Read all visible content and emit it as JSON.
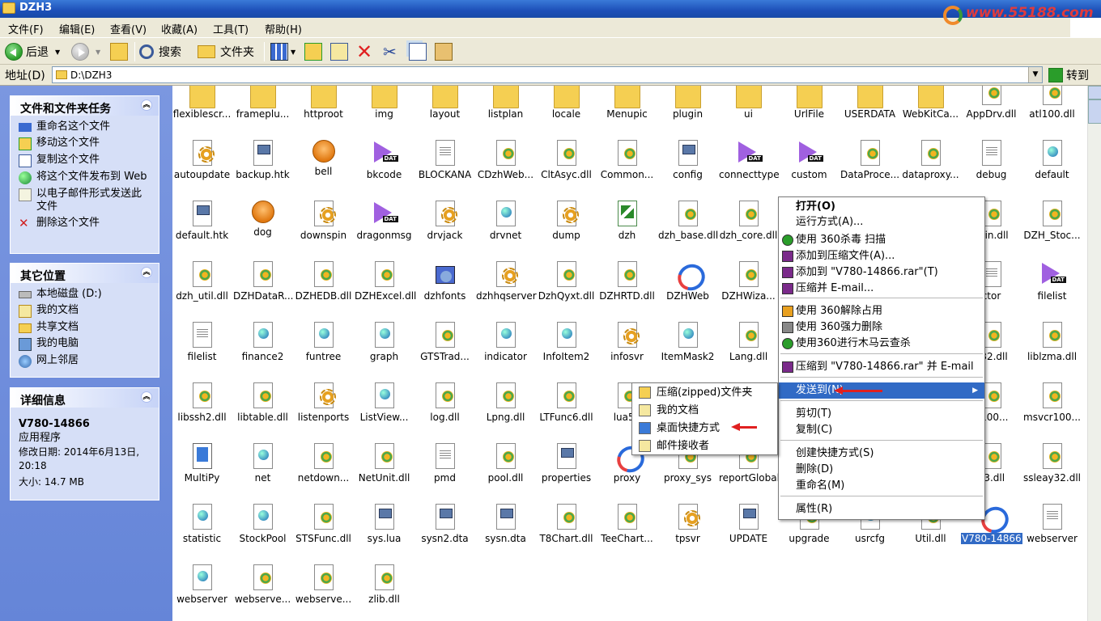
{
  "window": {
    "title": "DZH3"
  },
  "watermark": {
    "text": "www.55188.com"
  },
  "menubar": {
    "items": [
      "文件(F)",
      "编辑(E)",
      "查看(V)",
      "收藏(A)",
      "工具(T)",
      "帮助(H)"
    ]
  },
  "toolbar": {
    "back": "后退",
    "search": "搜索",
    "folders": "文件夹"
  },
  "address": {
    "label": "地址(D)",
    "value": "D:\\DZH3",
    "go": "转到"
  },
  "sidebar": {
    "tasks": {
      "title": "文件和文件夹任务",
      "items": [
        "重命名这个文件",
        "移动这个文件",
        "复制这个文件",
        "将这个文件发布到 Web",
        "以电子邮件形式发送此文件",
        "删除这个文件"
      ]
    },
    "places": {
      "title": "其它位置",
      "items": [
        "本地磁盘 (D:)",
        "我的文档",
        "共享文档",
        "我的电脑",
        "网上邻居"
      ]
    },
    "details": {
      "title": "详细信息",
      "name": "V780-14866",
      "type": "应用程序",
      "modified": "修改日期: 2014年6月13日, 20:18",
      "size": "大小: 14.7 MB"
    }
  },
  "files": [
    {
      "name": "flexiblescr...",
      "icon": "folder"
    },
    {
      "name": "frameplu...",
      "icon": "folder"
    },
    {
      "name": "httproot",
      "icon": "folder"
    },
    {
      "name": "img",
      "icon": "folder"
    },
    {
      "name": "layout",
      "icon": "folder"
    },
    {
      "name": "listplan",
      "icon": "folder"
    },
    {
      "name": "locale",
      "icon": "folder"
    },
    {
      "name": "Menupic",
      "icon": "folder"
    },
    {
      "name": "plugin",
      "icon": "folder"
    },
    {
      "name": "ui",
      "icon": "folder"
    },
    {
      "name": "UrlFile",
      "icon": "folder"
    },
    {
      "name": "USERDATA",
      "icon": "folder"
    },
    {
      "name": "WebKitCa...",
      "icon": "folder"
    },
    {
      "name": "AppDrv.dll",
      "icon": "dll"
    },
    {
      "name": "atl100.dll",
      "icon": "dll"
    },
    {
      "name": "autoupdate",
      "icon": "gear"
    },
    {
      "name": "backup.htk",
      "icon": "htk"
    },
    {
      "name": "bell",
      "icon": "round"
    },
    {
      "name": "bkcode",
      "icon": "dat"
    },
    {
      "name": "BLOCKANA",
      "icon": "doc"
    },
    {
      "name": "CDzhWeb...",
      "icon": "dll"
    },
    {
      "name": "CltAsyc.dll",
      "icon": "dll"
    },
    {
      "name": "Common...",
      "icon": "dll"
    },
    {
      "name": "config",
      "icon": "htk"
    },
    {
      "name": "connecttype",
      "icon": "dat"
    },
    {
      "name": "custom",
      "icon": "dat"
    },
    {
      "name": "DataProce...",
      "icon": "dll"
    },
    {
      "name": "dataproxy...",
      "icon": "dll"
    },
    {
      "name": "debug",
      "icon": "doc"
    },
    {
      "name": "default",
      "icon": "web"
    },
    {
      "name": "default.htk",
      "icon": "htk"
    },
    {
      "name": "dog",
      "icon": "round"
    },
    {
      "name": "downspin",
      "icon": "gear"
    },
    {
      "name": "dragonmsg",
      "icon": "dat"
    },
    {
      "name": "drvjack",
      "icon": "gear"
    },
    {
      "name": "drvnet",
      "icon": "web"
    },
    {
      "name": "dump",
      "icon": "gear"
    },
    {
      "name": "dzh",
      "icon": "xls"
    },
    {
      "name": "dzh_base.dll",
      "icon": "dll"
    },
    {
      "name": "dzh_core.dll",
      "icon": "dll"
    },
    {
      "name": "",
      "icon": "none"
    },
    {
      "name": "",
      "icon": "none"
    },
    {
      "name": "",
      "icon": "none"
    },
    {
      "name": "skin.dll",
      "icon": "dll"
    },
    {
      "name": "DZH_Stoc...",
      "icon": "dll"
    },
    {
      "name": "dzh_util.dll",
      "icon": "dll"
    },
    {
      "name": "DZHDataR...",
      "icon": "dll"
    },
    {
      "name": "DZHEDB.dll",
      "icon": "dll"
    },
    {
      "name": "DZHExcel.dll",
      "icon": "dll"
    },
    {
      "name": "dzhfonts",
      "icon": "install"
    },
    {
      "name": "dzhhqserver",
      "icon": "gear"
    },
    {
      "name": "DzhQyxt.dll",
      "icon": "dll"
    },
    {
      "name": "DZHRTD.dll",
      "icon": "dll"
    },
    {
      "name": "DZHWeb",
      "icon": "app"
    },
    {
      "name": "DZHWiza...",
      "icon": "dll"
    },
    {
      "name": "",
      "icon": "none"
    },
    {
      "name": "",
      "icon": "none"
    },
    {
      "name": "",
      "icon": "none"
    },
    {
      "name": "ctor",
      "icon": "doc"
    },
    {
      "name": "filelist",
      "icon": "dat"
    },
    {
      "name": "filelist",
      "icon": "doc"
    },
    {
      "name": "finance2",
      "icon": "web"
    },
    {
      "name": "funtree",
      "icon": "web"
    },
    {
      "name": "graph",
      "icon": "web"
    },
    {
      "name": "GTSTrad...",
      "icon": "dll"
    },
    {
      "name": "indicator",
      "icon": "web"
    },
    {
      "name": "InfoItem2",
      "icon": "web"
    },
    {
      "name": "infosvr",
      "icon": "gear"
    },
    {
      "name": "ItemMask2",
      "icon": "web"
    },
    {
      "name": "Lang.dll",
      "icon": "dll"
    },
    {
      "name": "",
      "icon": "none"
    },
    {
      "name": "",
      "icon": "none"
    },
    {
      "name": "",
      "icon": "none"
    },
    {
      "name": "y32.dll",
      "icon": "dll"
    },
    {
      "name": "liblzma.dll",
      "icon": "dll"
    },
    {
      "name": "libssh2.dll",
      "icon": "dll"
    },
    {
      "name": "libtable.dll",
      "icon": "dll"
    },
    {
      "name": "listenports",
      "icon": "gear"
    },
    {
      "name": "ListView...",
      "icon": "web"
    },
    {
      "name": "log.dll",
      "icon": "dll"
    },
    {
      "name": "Lpng.dll",
      "icon": "dll"
    },
    {
      "name": "LTFunc6.dll",
      "icon": "dll"
    },
    {
      "name": "lua51",
      "icon": "dll"
    },
    {
      "name": "",
      "icon": "none"
    },
    {
      "name": "",
      "icon": "none"
    },
    {
      "name": "",
      "icon": "none"
    },
    {
      "name": "",
      "icon": "none"
    },
    {
      "name": "",
      "icon": "none"
    },
    {
      "name": "p100...",
      "icon": "dll"
    },
    {
      "name": "msvcr100...",
      "icon": "dll"
    },
    {
      "name": "MultiPy",
      "icon": "multi"
    },
    {
      "name": "net",
      "icon": "web"
    },
    {
      "name": "netdown...",
      "icon": "dll"
    },
    {
      "name": "NetUnit.dll",
      "icon": "dll"
    },
    {
      "name": "pmd",
      "icon": "doc"
    },
    {
      "name": "pool.dll",
      "icon": "dll"
    },
    {
      "name": "properties",
      "icon": "htk"
    },
    {
      "name": "proxy",
      "icon": "app"
    },
    {
      "name": "proxy_sys",
      "icon": "dll"
    },
    {
      "name": "reportGlobal",
      "icon": "dll"
    },
    {
      "name": "",
      "icon": "none"
    },
    {
      "name": "",
      "icon": "none"
    },
    {
      "name": "",
      "icon": "none"
    },
    {
      "name": "e3.dll",
      "icon": "dll"
    },
    {
      "name": "ssleay32.dll",
      "icon": "dll"
    },
    {
      "name": "statistic",
      "icon": "web"
    },
    {
      "name": "StockPool",
      "icon": "web"
    },
    {
      "name": "STSFunc.dll",
      "icon": "dll"
    },
    {
      "name": "sys.lua",
      "icon": "htk"
    },
    {
      "name": "sysn2.dta",
      "icon": "htk"
    },
    {
      "name": "sysn.dta",
      "icon": "htk"
    },
    {
      "name": "T8Chart.dll",
      "icon": "dll"
    },
    {
      "name": "TeeChart...",
      "icon": "dll"
    },
    {
      "name": "tpsvr",
      "icon": "gear"
    },
    {
      "name": "UPDATE",
      "icon": "htk"
    },
    {
      "name": "upgrade",
      "icon": "dll"
    },
    {
      "name": "usrcfg",
      "icon": "web"
    },
    {
      "name": "Util.dll",
      "icon": "dll"
    },
    {
      "name": "V780-14866",
      "icon": "app",
      "selected": true
    },
    {
      "name": "webserver",
      "icon": "doc"
    },
    {
      "name": "webserver",
      "icon": "web"
    },
    {
      "name": "webserve...",
      "icon": "dll"
    },
    {
      "name": "webserve...",
      "icon": "dll"
    },
    {
      "name": "zlib.dll",
      "icon": "dll"
    }
  ],
  "context_menu": {
    "items": [
      {
        "label": "打开(O)",
        "bold": true
      },
      {
        "label": "运行方式(A)..."
      },
      {
        "label": "使用 360杀毒 扫描",
        "icon": "shield"
      },
      {
        "label": "添加到压缩文件(A)...",
        "icon": "rar"
      },
      {
        "label": "添加到 \"V780-14866.rar\"(T)",
        "icon": "rar"
      },
      {
        "label": "压缩并 E-mail...",
        "icon": "rar"
      },
      {
        "label": "使用 360解除占用",
        "icon": "unlock"
      },
      {
        "label": "使用 360强力删除",
        "icon": "trash"
      },
      {
        "label": "使用360进行木马云查杀",
        "icon": "cloud"
      },
      {
        "label": "压缩到 \"V780-14866.rar\" 并 E-mail",
        "icon": "rar"
      },
      {
        "label": "发送到(N)",
        "submenu": true,
        "highlighted": true
      },
      {
        "label": "剪切(T)"
      },
      {
        "label": "复制(C)"
      },
      {
        "label": "创建快捷方式(S)"
      },
      {
        "label": "删除(D)"
      },
      {
        "label": "重命名(M)"
      },
      {
        "label": "属性(R)"
      }
    ]
  },
  "send_to_menu": {
    "items": [
      "压缩(zipped)文件夹",
      "我的文档",
      "桌面快捷方式",
      "邮件接收者"
    ]
  },
  "colors": {
    "highlight": "#316ac5",
    "titlebar": "#1d4fb8",
    "sidebar": "#7a96df"
  }
}
